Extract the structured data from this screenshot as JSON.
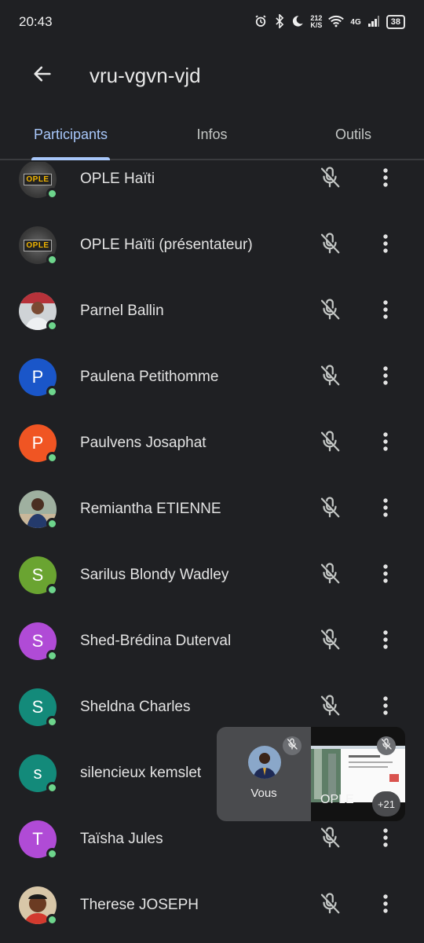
{
  "status_bar": {
    "time": "20:43",
    "speed_value": "212",
    "speed_unit": "K/S",
    "network": "4G",
    "battery": "38"
  },
  "header": {
    "title": "vru-vgvn-vjd",
    "back_icon": "arrow-left-icon"
  },
  "tabs": [
    {
      "label": "Participants",
      "active": true
    },
    {
      "label": "Infos",
      "active": false
    },
    {
      "label": "Outils",
      "active": false
    }
  ],
  "colors": {
    "background": "#1f2023",
    "accent": "#a8c7fa",
    "online": "#6dd58c"
  },
  "participants": [
    {
      "name": "OPLE Haïti",
      "avatar_type": "logo",
      "logo_text": "OPLE",
      "online": true,
      "mic": "muted"
    },
    {
      "name": "OPLE Haïti (présentateur)",
      "avatar_type": "logo",
      "logo_text": "OPLE",
      "online": true,
      "mic": "muted"
    },
    {
      "name": "Parnel Ballin",
      "avatar_type": "photo",
      "online": true,
      "mic": "muted"
    },
    {
      "name": "Paulena Petithomme",
      "avatar_type": "initial",
      "initial": "P",
      "color": "#1a56c9",
      "online": true,
      "mic": "muted"
    },
    {
      "name": "Paulvens Josaphat",
      "avatar_type": "initial",
      "initial": "P",
      "color": "#f05523",
      "online": true,
      "mic": "muted"
    },
    {
      "name": "Remiantha ETIENNE",
      "avatar_type": "photo",
      "online": true,
      "mic": "muted"
    },
    {
      "name": "Sarilus Blondy Wadley",
      "avatar_type": "initial",
      "initial": "S",
      "color": "#6aa431",
      "online": true,
      "mic": "muted"
    },
    {
      "name": "Shed-Brédina Duterval",
      "avatar_type": "initial",
      "initial": "S",
      "color": "#b04bd6",
      "online": true,
      "mic": "muted"
    },
    {
      "name": "Sheldna Charles",
      "avatar_type": "initial",
      "initial": "S",
      "color": "#138a7a",
      "online": true,
      "mic": "muted"
    },
    {
      "name": "silencieux kemslet",
      "avatar_type": "initial",
      "initial": "s",
      "color": "#138a7a",
      "online": true,
      "mic": "muted"
    },
    {
      "name": "Taïsha Jules",
      "avatar_type": "initial",
      "initial": "T",
      "color": "#b04bd6",
      "online": true,
      "mic": "muted"
    },
    {
      "name": "Therese JOSEPH",
      "avatar_type": "photo",
      "online": true,
      "mic": "muted"
    }
  ],
  "pip": {
    "self_label": "Vous",
    "presenter_label": "OPLE",
    "others_count": "+21"
  }
}
